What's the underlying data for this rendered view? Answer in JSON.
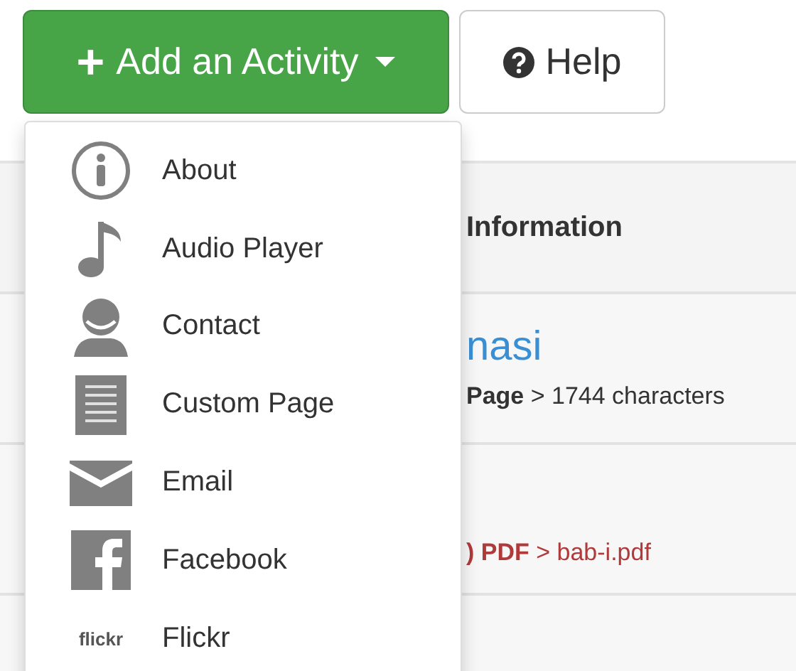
{
  "toolbar": {
    "add_button": {
      "label": "Add an Activity",
      "icon": "+"
    },
    "help_button": {
      "label": "Help"
    }
  },
  "menu": {
    "items": [
      {
        "kind": "about",
        "label": "About"
      },
      {
        "kind": "audio",
        "label": "Audio Player"
      },
      {
        "kind": "contact",
        "label": "Contact"
      },
      {
        "kind": "page",
        "label": "Custom Page"
      },
      {
        "kind": "email",
        "label": "Email"
      },
      {
        "kind": "facebook",
        "label": "Facebook"
      },
      {
        "kind": "flickr",
        "label": "Flickr",
        "icon_text": "flickr"
      }
    ]
  },
  "table": {
    "column_header": "Information",
    "rows": [
      {
        "kind": "page",
        "title": "nasi",
        "detail": "**Page** > 1744 characters"
      },
      {
        "kind": "file",
        "detail": "**) PDF** > bab-i.pdf"
      },
      {
        "kind": "empty"
      }
    ]
  }
}
